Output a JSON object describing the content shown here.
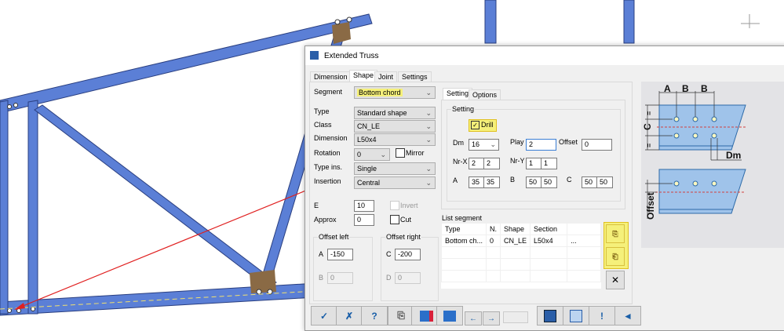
{
  "dialog": {
    "title": "Extended Truss",
    "tabs": [
      "Dimension",
      "Shape",
      "Joint",
      "Settings"
    ],
    "segment": {
      "label": "Segment",
      "value": "Bottom chord"
    },
    "type": {
      "label": "Type",
      "value": "Standard shape"
    },
    "class": {
      "label": "Class",
      "value": "CN_LE"
    },
    "dimension": {
      "label": "Dimension",
      "value": "L50x4"
    },
    "rotation": {
      "label": "Rotation",
      "value": "0"
    },
    "mirror": "Mirror",
    "type_ins": {
      "label": "Type ins.",
      "value": "Single"
    },
    "insertion": {
      "label": "Insertion",
      "value": "Central"
    },
    "e": {
      "label": "E",
      "value": "10"
    },
    "invert": "Invert",
    "approx": {
      "label": "Approx",
      "value": "0"
    },
    "cut": "Cut",
    "offset_left": {
      "title": "Offset left",
      "a_label": "A",
      "a": "-150",
      "b_label": "B",
      "b": "0"
    },
    "offset_right": {
      "title": "Offset right",
      "c_label": "C",
      "c": "-200",
      "d_label": "D",
      "d": "0"
    },
    "sub_tabs": [
      "Setting",
      "Options"
    ],
    "setting": {
      "title": "Setting",
      "drill": "Drill",
      "dm_label": "Dm",
      "dm": "16",
      "play_label": "Play",
      "play": "2",
      "offset_label": "Offset",
      "offset": "0",
      "nrx_label": "Nr-X",
      "nrx": [
        "2",
        "2"
      ],
      "nry_label": "Nr-Y",
      "nry": [
        "1",
        "1"
      ],
      "a_label": "A",
      "a": [
        "35",
        "35"
      ],
      "b_label": "B",
      "b": [
        "50",
        "50"
      ],
      "c_label": "C",
      "c": [
        "50",
        "50"
      ]
    },
    "list": {
      "title": "List segment",
      "headers": [
        "Type",
        "N.",
        "Shape",
        "Section",
        ""
      ],
      "rows": [
        [
          "Bottom ch...",
          "0",
          "CN_LE",
          "L50x4",
          "..."
        ]
      ]
    },
    "close_glyph": "✕",
    "diagram": {
      "labels": [
        "A",
        "B",
        "B",
        "C",
        "=",
        "=",
        "Dm",
        "Offset"
      ]
    },
    "toolbar": [
      "✓",
      "✗",
      "?",
      "⎘",
      "",
      "",
      "←",
      "→",
      "",
      "",
      "!",
      "◄"
    ]
  },
  "colors": {
    "member": "#5b7fd6",
    "highlight": "#f5f07a",
    "arrow": "#e02020"
  }
}
